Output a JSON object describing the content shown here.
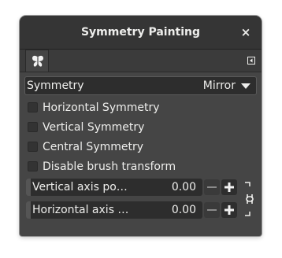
{
  "window": {
    "title": "Symmetry Painting",
    "close_glyph": "×"
  },
  "tabs": [
    {
      "icon": "butterfly-icon"
    }
  ],
  "symmetry": {
    "label": "Symmetry",
    "value": "Mirror"
  },
  "options": [
    {
      "label": "Horizontal Symmetry",
      "checked": false
    },
    {
      "label": "Vertical Symmetry",
      "checked": false
    },
    {
      "label": "Central Symmetry",
      "checked": false
    },
    {
      "label": "Disable brush transform",
      "checked": false
    }
  ],
  "axes": [
    {
      "label": "Vertical axis po…",
      "value": "0.00"
    },
    {
      "label": "Horizontal axis …",
      "value": "0.00"
    }
  ],
  "icons": {
    "chain": "chain-link-icon",
    "decrement": "minus-icon",
    "increment": "plus-icon",
    "tab_menu": "tab-menu-icon",
    "dropdown": "chevron-down-icon"
  },
  "colors": {
    "panel": "#454545",
    "titlebar": "#353535",
    "text": "#eeeeec",
    "field": "#2d2d2d"
  }
}
